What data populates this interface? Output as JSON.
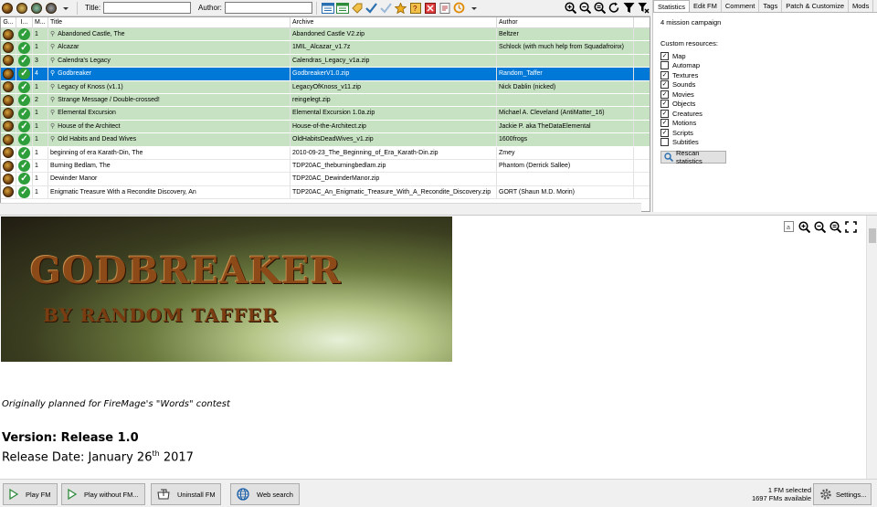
{
  "toolbar": {
    "title_label": "Title:",
    "author_label": "Author:",
    "title_value": "",
    "author_value": ""
  },
  "grid": {
    "headers": [
      "G...",
      "I...",
      "M...",
      "Title",
      "Archive",
      "Author"
    ],
    "rows": [
      {
        "style": "green",
        "m": "1",
        "title": "Abandoned Castle, The",
        "archive": "Abandoned Castle V2.zip",
        "author": "Beltzer"
      },
      {
        "style": "green",
        "m": "1",
        "title": "Alcazar",
        "archive": "1MIL_Alcazar_v1.7z",
        "author": "Schlock (with much help from Squadafroinx)"
      },
      {
        "style": "green",
        "m": "3",
        "title": "Calendra's Legacy",
        "archive": "Calendras_Legacy_v1a.zip",
        "author": ""
      },
      {
        "style": "sel",
        "m": "4",
        "title": "Godbreaker",
        "archive": "GodbreakerV1.0.zip",
        "author": "Random_Taffer"
      },
      {
        "style": "green",
        "m": "1",
        "title": "Legacy of Knoss (v1.1)",
        "archive": "LegacyOfKnoss_v11.zip",
        "author": "Nick Dablin (nicked)"
      },
      {
        "style": "green",
        "m": "2",
        "title": "Strange Message / Double-crossed!",
        "archive": "reingelegt.zip",
        "author": ""
      },
      {
        "style": "green",
        "m": "1",
        "title": "Elemental Excursion",
        "archive": "Elemental Excursion 1.0a.zip",
        "author": "Michael A. Cleveland (AntiMatter_16)"
      },
      {
        "style": "green",
        "m": "1",
        "title": "House of the Architect",
        "archive": "House-of-the-Architect.zip",
        "author": "Jackie P. aka TheDataElemental"
      },
      {
        "style": "green",
        "m": "1",
        "title": "Old Habits and Dead Wives",
        "archive": "OldHabitsDeadWives_v1.zip",
        "author": "1600frogs"
      },
      {
        "style": "white",
        "m": "1",
        "title": "beginning of era Karath-Din, The",
        "archive": "2010-09-23_The_Beginning_of_Era_Karath-Din.zip",
        "author": "Zmey"
      },
      {
        "style": "white",
        "m": "1",
        "title": "Burning Bedlam, The",
        "archive": "TDP20AC_theburningbedlam.zip",
        "author": "Phantom (Derrick Sallee)"
      },
      {
        "style": "white",
        "m": "1",
        "title": "Dewinder Manor",
        "archive": "TDP20AC_DewinderManor.zip",
        "author": ""
      },
      {
        "style": "white",
        "m": "1",
        "title": "Enigmatic Treasure With a Recondite Discovery, An",
        "archive": "TDP20AC_An_Enigmatic_Treasure_With_A_Recondite_Discovery.zip",
        "author": "GORT (Shaun M.D. Morin)"
      }
    ]
  },
  "rpanel": {
    "tabs": [
      "Statistics",
      "Edit FM",
      "Comment",
      "Tags",
      "Patch & Customize",
      "Mods"
    ],
    "campaign": "4 mission campaign",
    "custom_label": "Custom resources:",
    "resources": [
      {
        "label": "Map",
        "checked": true
      },
      {
        "label": "Automap",
        "checked": false
      },
      {
        "label": "Textures",
        "checked": true
      },
      {
        "label": "Sounds",
        "checked": true
      },
      {
        "label": "Movies",
        "checked": true
      },
      {
        "label": "Objects",
        "checked": true
      },
      {
        "label": "Creatures",
        "checked": true
      },
      {
        "label": "Motions",
        "checked": true
      },
      {
        "label": "Scripts",
        "checked": true
      },
      {
        "label": "Subtitles",
        "checked": false
      }
    ],
    "rescan": "Rescan statistics"
  },
  "readme": {
    "banner_title": "GODBREAKER",
    "banner_sub": "BY RANDOM TAFFER",
    "contest": "Originally planned for FireMage's \"Words\" contest",
    "version": "Version: Release 1.0",
    "release_prefix": "Release Date:  January 26",
    "release_sup": "th",
    "release_suffix": " 2017"
  },
  "bottom": {
    "play": "Play FM",
    "play_without": "Play without FM...",
    "uninstall": "Uninstall FM",
    "web": "Web search",
    "selected": "1 FM selected",
    "available": "1697 FMs available",
    "settings": "Settings..."
  },
  "colors": {
    "selected_row": "#0078d7",
    "installed_row": "#c7e2c2",
    "accent_green": "#2e9e3a"
  }
}
